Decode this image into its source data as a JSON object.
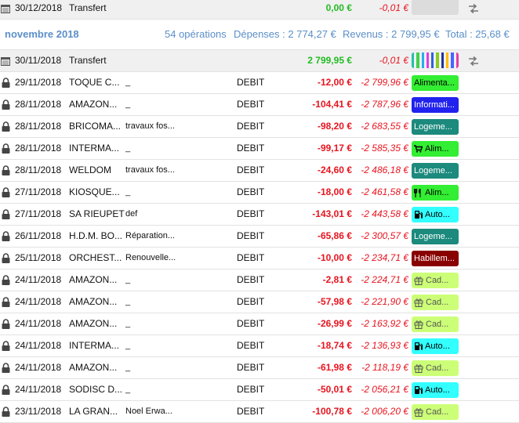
{
  "top_transfer": {
    "date": "30/12/2018",
    "payee": "Transfert",
    "amount": "0,00 €",
    "balance": "-0,01 €"
  },
  "month": {
    "title": "novembre 2018",
    "operations": "54 opérations",
    "expenses": "Dépenses : 2 774,27 €",
    "income": "Revenus : 2 799,95 €",
    "total": "Total : 25,68 €"
  },
  "month_transfer": {
    "date": "30/11/2018",
    "payee": "Transfert",
    "amount": "2 799,95 €",
    "balance": "-0,01 €",
    "stripe_colors": [
      "#22c0ad",
      "#44d04a",
      "#22b0f0",
      "#e040e0",
      "#3060e0",
      "#88cc22",
      "#223399",
      "#fb0",
      "#4466ff",
      "#e040aa"
    ]
  },
  "rows": [
    {
      "date": "29/11/2018",
      "payee": "TOQUE C...",
      "memo": "_",
      "type": "DEBIT",
      "amount": "-12,00 €",
      "balance": "-2 799,96 €",
      "category": "Alimenta...",
      "cat_bg": "#33ee33",
      "cat_fg": "#000000",
      "cat_icon": ""
    },
    {
      "date": "28/11/2018",
      "payee": "AMAZON...",
      "memo": "_",
      "type": "DEBIT",
      "amount": "-104,41 €",
      "balance": "-2 787,96 €",
      "category": "Informati...",
      "cat_bg": "#2222ee",
      "cat_fg": "#ffffff",
      "cat_icon": ""
    },
    {
      "date": "28/11/2018",
      "payee": "BRICOMA...",
      "memo": "travaux fos...",
      "type": "DEBIT",
      "amount": "-98,20 €",
      "balance": "-2 683,55 €",
      "category": "Logeme...",
      "cat_bg": "#1c8a7d",
      "cat_fg": "#ffffff",
      "cat_icon": ""
    },
    {
      "date": "28/11/2018",
      "payee": "INTERMA...",
      "memo": "_",
      "type": "DEBIT",
      "amount": "-99,17 €",
      "balance": "-2 585,35 €",
      "category": "Alim...",
      "cat_bg": "#33ee33",
      "cat_fg": "#000000",
      "cat_icon": "cart"
    },
    {
      "date": "28/11/2018",
      "payee": "WELDOM",
      "memo": "travaux fos...",
      "type": "DEBIT",
      "amount": "-24,60 €",
      "balance": "-2 486,18 €",
      "category": "Logeme...",
      "cat_bg": "#1c8a7d",
      "cat_fg": "#ffffff",
      "cat_icon": ""
    },
    {
      "date": "27/11/2018",
      "payee": "KIOSQUE...",
      "memo": "_",
      "type": "DEBIT",
      "amount": "-18,00 €",
      "balance": "-2 461,58 €",
      "category": "Alim...",
      "cat_bg": "#33ee33",
      "cat_fg": "#000000",
      "cat_icon": "cutlery"
    },
    {
      "date": "27/11/2018",
      "payee": "SA RIEUPET",
      "memo": "def",
      "type": "DEBIT",
      "amount": "-143,01 €",
      "balance": "-2 443,58 €",
      "category": "Auto...",
      "cat_bg": "#33ffff",
      "cat_fg": "#000000",
      "cat_icon": "fuel"
    },
    {
      "date": "26/11/2018",
      "payee": "H.D.M. BO...",
      "memo": "Réparation...",
      "type": "DEBIT",
      "amount": "-65,86 €",
      "balance": "-2 300,57 €",
      "category": "Logeme...",
      "cat_bg": "#1c8a7d",
      "cat_fg": "#ffffff",
      "cat_icon": ""
    },
    {
      "date": "25/11/2018",
      "payee": "ORCHEST...",
      "memo": "Renouvelle...",
      "type": "DEBIT",
      "amount": "-10,00 €",
      "balance": "-2 234,71 €",
      "category": "Habillem...",
      "cat_bg": "#880000",
      "cat_fg": "#ffffff",
      "cat_icon": ""
    },
    {
      "date": "24/11/2018",
      "payee": "AMAZON...",
      "memo": "_",
      "type": "DEBIT",
      "amount": "-2,81 €",
      "balance": "-2 224,71 €",
      "category": "Cad...",
      "cat_bg": "#ccff77",
      "cat_fg": "#555555",
      "cat_icon": "gift"
    },
    {
      "date": "24/11/2018",
      "payee": "AMAZON...",
      "memo": "_",
      "type": "DEBIT",
      "amount": "-57,98 €",
      "balance": "-2 221,90 €",
      "category": "Cad...",
      "cat_bg": "#ccff77",
      "cat_fg": "#555555",
      "cat_icon": "gift"
    },
    {
      "date": "24/11/2018",
      "payee": "AMAZON...",
      "memo": "_",
      "type": "DEBIT",
      "amount": "-26,99 €",
      "balance": "-2 163,92 €",
      "category": "Cad...",
      "cat_bg": "#ccff77",
      "cat_fg": "#555555",
      "cat_icon": "gift"
    },
    {
      "date": "24/11/2018",
      "payee": "INTERMA...",
      "memo": "_",
      "type": "DEBIT",
      "amount": "-18,74 €",
      "balance": "-2 136,93 €",
      "category": "Auto...",
      "cat_bg": "#33ffff",
      "cat_fg": "#000000",
      "cat_icon": "fuel"
    },
    {
      "date": "24/11/2018",
      "payee": "AMAZON...",
      "memo": "_",
      "type": "DEBIT",
      "amount": "-61,98 €",
      "balance": "-2 118,19 €",
      "category": "Cad...",
      "cat_bg": "#ccff77",
      "cat_fg": "#555555",
      "cat_icon": "gift"
    },
    {
      "date": "24/11/2018",
      "payee": "SODISC D...",
      "memo": "_",
      "type": "DEBIT",
      "amount": "-50,01 €",
      "balance": "-2 056,21 €",
      "category": "Auto...",
      "cat_bg": "#33ffff",
      "cat_fg": "#000000",
      "cat_icon": "fuel"
    },
    {
      "date": "23/11/2018",
      "payee": "LA GRAN...",
      "memo": "Noel Erwa...",
      "type": "DEBIT",
      "amount": "-100,78 €",
      "balance": "-2 006,20 €",
      "category": "Cad...",
      "cat_bg": "#ccff77",
      "cat_fg": "#555555",
      "cat_icon": "gift"
    }
  ]
}
